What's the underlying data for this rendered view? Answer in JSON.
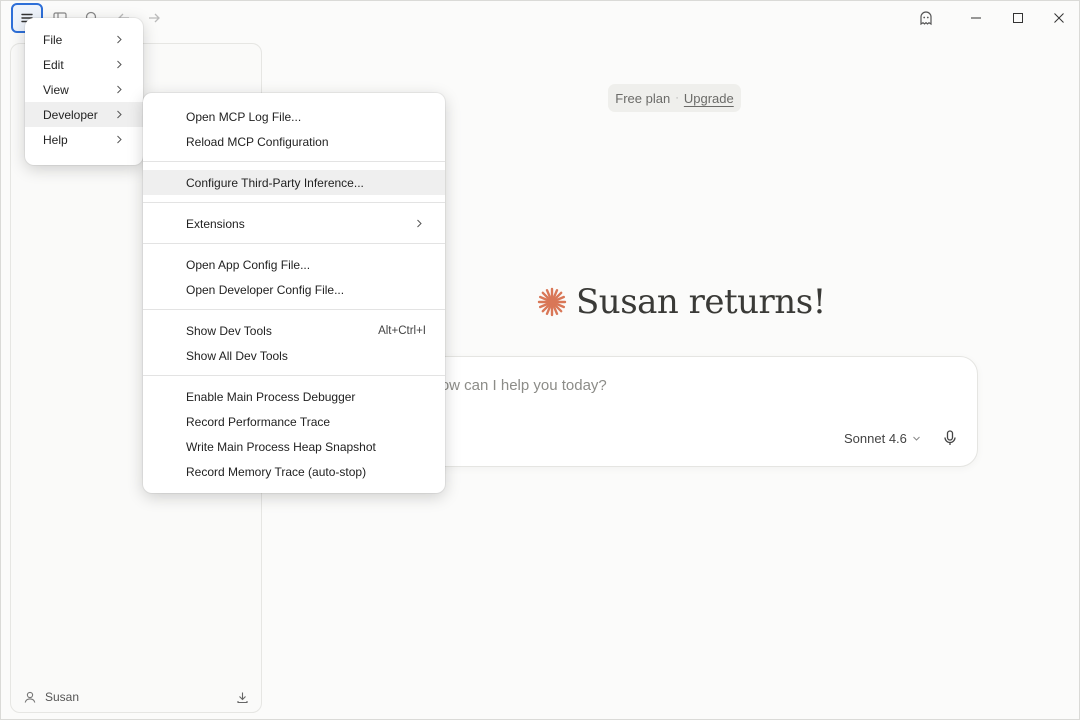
{
  "plan": {
    "label": "Free plan",
    "separator": "·",
    "upgrade": "Upgrade"
  },
  "greeting": "Susan returns!",
  "composer": {
    "placeholder": "How can I help you today?",
    "model": "Sonnet 4.6"
  },
  "sidebar": {
    "user_name": "Susan"
  },
  "main_menu": [
    {
      "label": "File"
    },
    {
      "label": "Edit"
    },
    {
      "label": "View"
    },
    {
      "label": "Developer"
    },
    {
      "label": "Help"
    }
  ],
  "developer_menu": {
    "groups": [
      [
        {
          "label": "Open MCP Log File..."
        },
        {
          "label": "Reload MCP Configuration"
        }
      ],
      [
        {
          "label": "Configure Third-Party Inference..."
        }
      ],
      [
        {
          "label": "Extensions"
        }
      ],
      [
        {
          "label": "Open App Config File..."
        },
        {
          "label": "Open Developer Config File..."
        }
      ],
      [
        {
          "label": "Show Dev Tools",
          "shortcut": "Alt+Ctrl+I"
        },
        {
          "label": "Show All Dev Tools"
        }
      ],
      [
        {
          "label": "Enable Main Process Debugger"
        },
        {
          "label": "Record Performance Trace"
        },
        {
          "label": "Write Main Process Heap Snapshot"
        },
        {
          "label": "Record Memory Trace (auto-stop)"
        }
      ]
    ]
  },
  "colors": {
    "accent": "#d97757",
    "focus_ring": "#2e6fd8"
  },
  "icons": [
    "hamburger-icon",
    "sidebar-toggle-icon",
    "search-icon",
    "back-arrow-icon",
    "forward-arrow-icon",
    "ghost-icon",
    "minimize-icon",
    "maximize-icon",
    "close-icon",
    "spark-icon",
    "microphone-icon",
    "user-icon",
    "download-icon",
    "chevron-right-icon"
  ]
}
